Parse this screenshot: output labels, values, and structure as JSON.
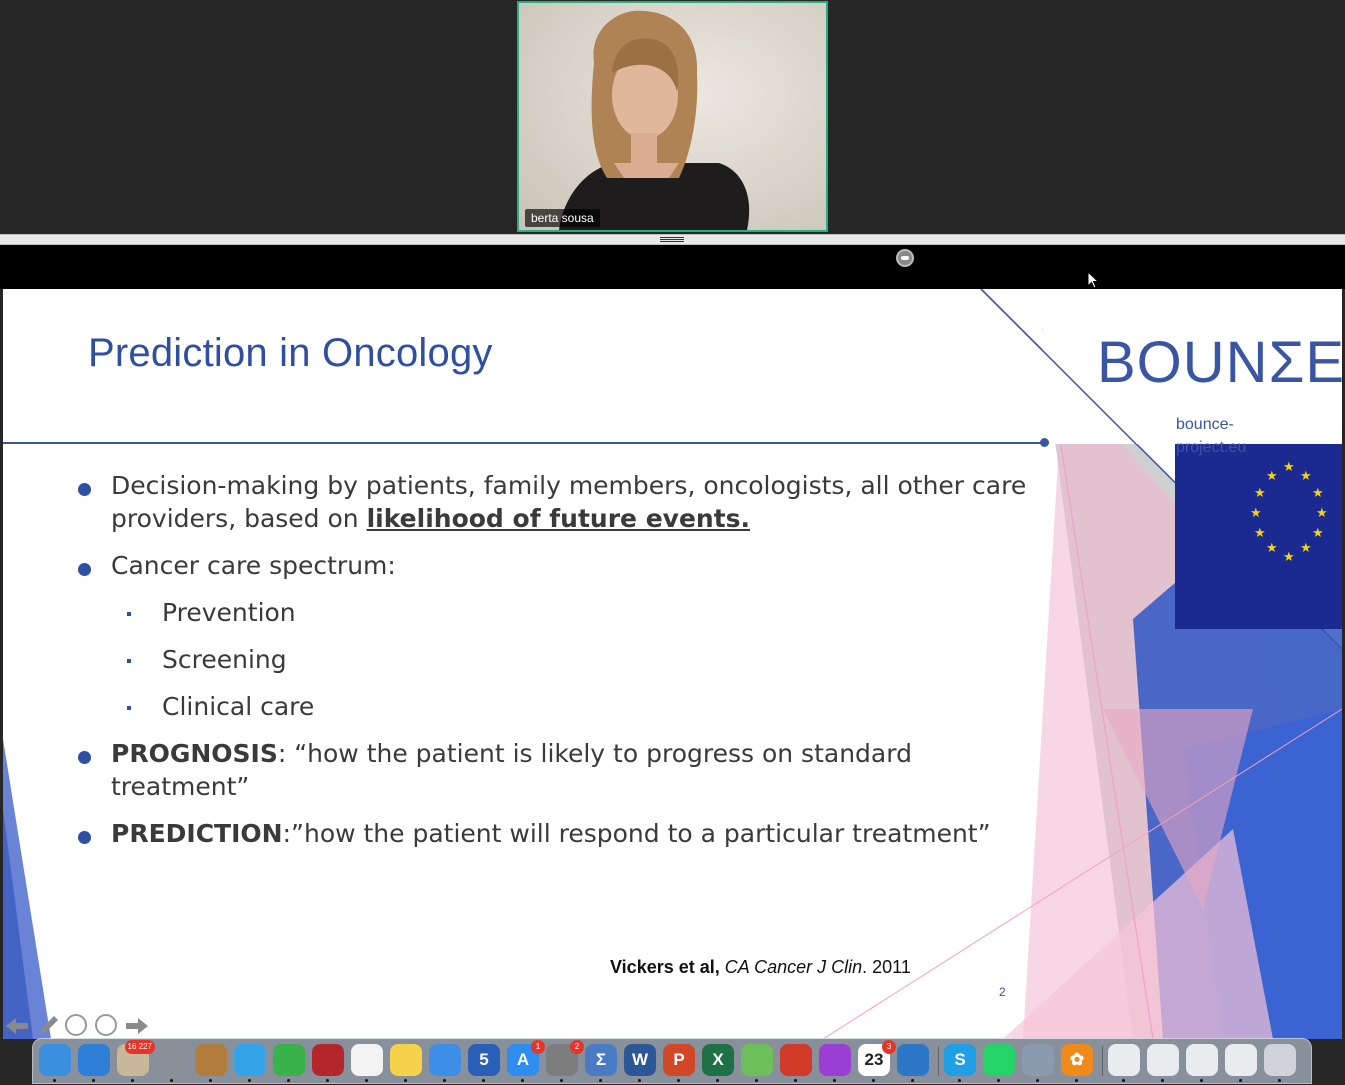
{
  "meeting": {
    "participant_name": "berta sousa"
  },
  "slide": {
    "title": "Prediction in Oncology",
    "logo_text": "BOUNΣE",
    "logo_url": "bounce-project.eu",
    "bullets": [
      {
        "prefix": "Decision-making by patients, family members, oncologists, all other care providers, based on ",
        "emphasis": "likelihood of future events."
      },
      {
        "text": "Cancer care spectrum:"
      },
      {
        "label": "PROGNOSIS",
        "text": ": “how the patient is likely to progress on standard treatment”"
      },
      {
        "label": "PREDICTION",
        "text": ":”how the patient will respond to a particular treatment”"
      }
    ],
    "sub_bullets": [
      "Prevention",
      "Screening",
      "Clinical care"
    ],
    "citation": {
      "authors": "Vickers et al,",
      "journal": "CA Cancer J Clin",
      "year": ". 2011"
    },
    "page_number": "2"
  },
  "dock": {
    "items": [
      {
        "name": "finder",
        "color": "#3b8fe0",
        "glyph": ""
      },
      {
        "name": "safari",
        "color": "#2d7fd8",
        "glyph": ""
      },
      {
        "name": "preview",
        "color": "#c9b79a",
        "glyph": "",
        "badge": "16 227"
      },
      {
        "name": "launchpad",
        "color": "#8a8f99",
        "glyph": ""
      },
      {
        "name": "contacts",
        "color": "#b27c3c",
        "glyph": ""
      },
      {
        "name": "messages",
        "color": "#35a3e8",
        "glyph": ""
      },
      {
        "name": "facetime",
        "color": "#37b34a",
        "glyph": ""
      },
      {
        "name": "photo-booth",
        "color": "#b3262b",
        "glyph": ""
      },
      {
        "name": "photos",
        "color": "#f3f3f3",
        "glyph": ""
      },
      {
        "name": "notes",
        "color": "#f5d24a",
        "glyph": ""
      },
      {
        "name": "keynote",
        "color": "#3d8ee6",
        "glyph": ""
      },
      {
        "name": "numbers-5",
        "color": "#2a5fb8",
        "glyph": "5"
      },
      {
        "name": "app-store",
        "color": "#2f8df0",
        "glyph": "A",
        "badge": "1"
      },
      {
        "name": "system-preferences",
        "color": "#7d7d7d",
        "glyph": "",
        "badge": "2"
      },
      {
        "name": "math-app",
        "color": "#4a7cc4",
        "glyph": "Σ"
      },
      {
        "name": "word",
        "color": "#2b5797",
        "glyph": "W"
      },
      {
        "name": "powerpoint",
        "color": "#d24726",
        "glyph": "P"
      },
      {
        "name": "excel",
        "color": "#1e7145",
        "glyph": "X"
      },
      {
        "name": "maps",
        "color": "#6cbf5b",
        "glyph": ""
      },
      {
        "name": "multicolor-app",
        "color": "#d23a2a",
        "glyph": ""
      },
      {
        "name": "podcasts",
        "color": "#9b3fd4",
        "glyph": ""
      },
      {
        "name": "calendar",
        "color": "#ffffff",
        "glyph": "23",
        "badge": "3"
      },
      {
        "name": "spiral-app",
        "color": "#2d77c9",
        "glyph": ""
      },
      {
        "name": "skype",
        "color": "#1fa0e6",
        "glyph": "S"
      },
      {
        "name": "whatsapp",
        "color": "#25d366",
        "glyph": ""
      },
      {
        "name": "image-capture",
        "color": "#8a9bb0",
        "glyph": ""
      },
      {
        "name": "flower-app",
        "color": "#f08a1a",
        "glyph": "✿"
      },
      {
        "name": "window-1",
        "color": "#e9ecef",
        "glyph": ""
      },
      {
        "name": "window-2",
        "color": "#e9ecef",
        "glyph": ""
      },
      {
        "name": "window-3",
        "color": "#e9ecef",
        "glyph": ""
      },
      {
        "name": "window-4",
        "color": "#e9ecef",
        "glyph": ""
      },
      {
        "name": "trash",
        "color": "#d0d4da",
        "glyph": ""
      }
    ]
  }
}
